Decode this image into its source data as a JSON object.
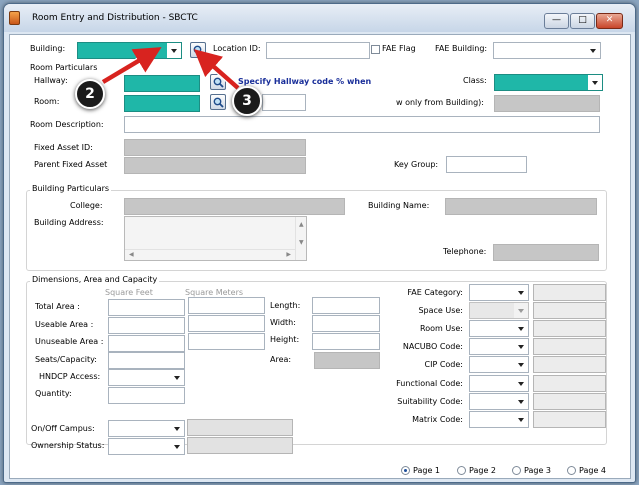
{
  "window": {
    "title": "Room Entry and Distribution - SBCTC"
  },
  "header": {
    "building_label": "Building:",
    "location_id_label": "Location ID:",
    "fae_flag_label": "FAE Flag",
    "fae_building_label": "FAE Building:"
  },
  "room_particulars": {
    "title": "Room Particulars",
    "hallway_label": "Hallway:",
    "room_label": "Room:",
    "hint_text": "Specify Hallway code  %  when",
    "class_label": "Class:",
    "partial_label": "w only from Building):",
    "room_description_label": "Room Description:",
    "fixed_asset_id_label": "Fixed Asset ID:",
    "parent_fixed_asset_label": "Parent Fixed Asset",
    "key_group_label": "Key Group:"
  },
  "building_particulars": {
    "title": "Building Particulars",
    "college_label": "College:",
    "building_name_label": "Building Name:",
    "building_address_label": "Building Address:",
    "telephone_label": "Telephone:"
  },
  "dimensions": {
    "title": "Dimensions, Area and Capacity",
    "col_square_feet": "Square Feet",
    "col_square_meters": "Square Meters",
    "total_area_label": "Total Area :",
    "useable_area_label": "Useable Area :",
    "unuseable_area_label": "Unuseable Area :",
    "seats_capacity_label": "Seats/Capacity:",
    "hndcp_access_label": "HNDCP Access:",
    "quantity_label": "Quantity:",
    "length_label": "Length:",
    "width_label": "Width:",
    "height_label": "Height:",
    "area_label": "Area:",
    "on_off_campus_label": "On/Off Campus:",
    "ownership_status_label": "Ownership Status:"
  },
  "codes": {
    "fae_category_label": "FAE Category:",
    "space_use_label": "Space Use:",
    "room_use_label": "Room Use:",
    "nacubo_code_label": "NACUBO Code:",
    "cip_code_label": "CIP Code:",
    "functional_code_label": "Functional Code:",
    "suitability_code_label": "Suitability Code:",
    "matrix_code_label": "Matrix Code:"
  },
  "pages": [
    {
      "label": "Page 1",
      "selected": true
    },
    {
      "label": "Page 2",
      "selected": false
    },
    {
      "label": "Page 3",
      "selected": false
    },
    {
      "label": "Page 4",
      "selected": false
    }
  ],
  "callouts": [
    "2",
    "3"
  ],
  "colors": {
    "teal_field": "#1fb7a8",
    "callout_arrow": "#d8231f",
    "readonly_field": "#c6c6c6"
  }
}
